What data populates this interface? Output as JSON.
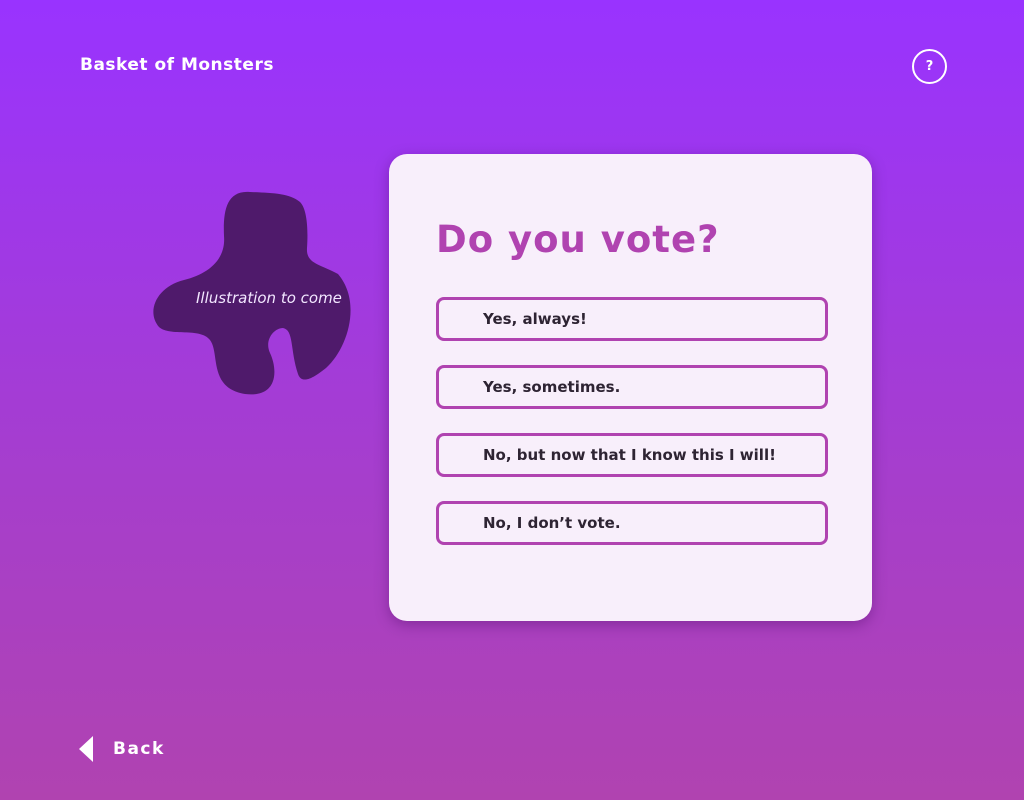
{
  "header": {
    "app_title": "Basket of Monsters",
    "help_label": "?"
  },
  "illustration": {
    "caption": "Illustration to come",
    "color": "#4f1a6b"
  },
  "question": {
    "title": "Do you vote?",
    "options": [
      {
        "label": "Yes, always!"
      },
      {
        "label": "Yes, sometimes."
      },
      {
        "label": "No, but now that I know this I will!"
      },
      {
        "label": "No, I don’t vote."
      }
    ]
  },
  "footer": {
    "back_label": "Back"
  },
  "colors": {
    "background_top": "#9933ff",
    "background_bottom": "#b043b0",
    "accent": "#b043b0",
    "card": "#f8effb"
  }
}
